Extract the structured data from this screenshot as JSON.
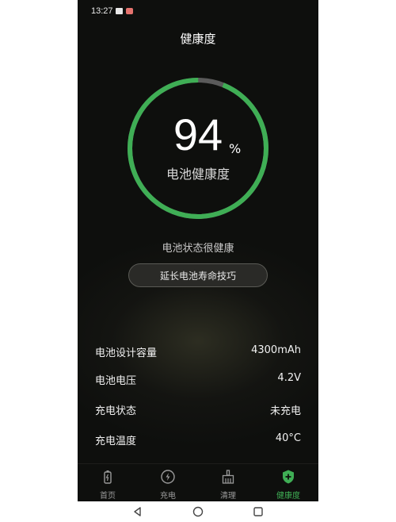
{
  "status_bar": {
    "time": "13:27"
  },
  "header": {
    "title": "健康度"
  },
  "health": {
    "percent": 94,
    "value_text": "94",
    "percent_sign": "%",
    "label": "电池健康度",
    "status_text": "电池状态很健康",
    "ring_color": "#3fae55",
    "ring_track_color": "#5a5a5a"
  },
  "tips_button": {
    "label": "延长电池寿命技巧"
  },
  "info": [
    {
      "label": "电池设计容量",
      "value": "4300mAh"
    },
    {
      "label": "电池电压",
      "value": "4.2V"
    },
    {
      "label": "充电状态",
      "value": "未充电"
    },
    {
      "label": "充电温度",
      "value": "40°C"
    }
  ],
  "nav": {
    "items": [
      {
        "label": "首页",
        "icon": "battery-icon"
      },
      {
        "label": "充电",
        "icon": "lightning-icon"
      },
      {
        "label": "清理",
        "icon": "broom-icon"
      },
      {
        "label": "健康度",
        "icon": "shield-plus-icon",
        "active": true
      }
    ],
    "active_color": "#3fae55"
  }
}
